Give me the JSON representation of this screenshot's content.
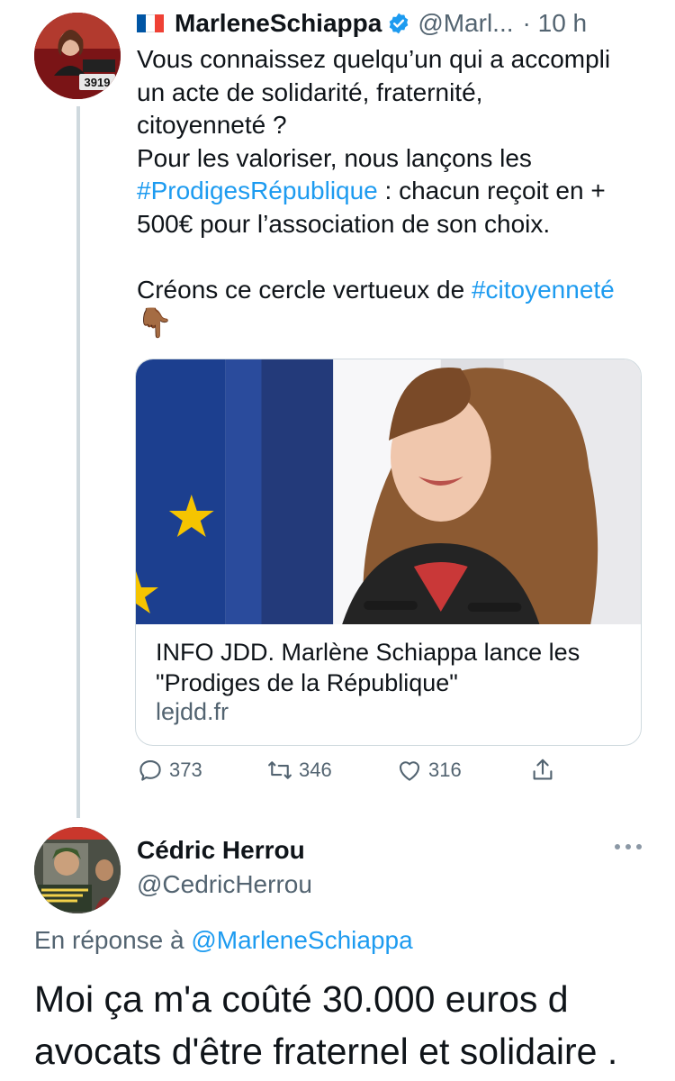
{
  "tweet": {
    "author_name": "MarleneSchiappa",
    "author_handle": "@Marl...",
    "time": "· 10 h",
    "flag_icon": "france-flag-icon",
    "avatar_badge": "3919",
    "text_parts": [
      "Vous connaissez quelqu’un qui a accompli\nun acte de solidarité, fraternité,\ncitoyenneté ?\nPour les valoriser, nous lançons les\n",
      "#ProdigesRépublique",
      " : chacun reçoit en +\n500€ pour l’association de son choix.\n\nCréons ce cercle vertueux de ",
      "#citoyenneté",
      "\n",
      "👇🏾"
    ],
    "card": {
      "title": "INFO JDD. Marlène Schiappa lance les \"Prodiges de la République\"",
      "domain": "lejdd.fr"
    },
    "actions": {
      "reply_count": "373",
      "retweet_count": "346",
      "like_count": "316"
    }
  },
  "reply": {
    "author_name": "Cédric Herrou",
    "author_handle": "@CedricHerrou",
    "reply_prefix": "En réponse à ",
    "reply_mention": "@MarleneSchiappa",
    "text": "Moi ça m'a coûté 30.000 euros d\navocats d'être fraternel et solidaire ."
  },
  "colors": {
    "link": "#1d9bf0",
    "secondary_text": "#536471",
    "border": "#cfd9de"
  }
}
